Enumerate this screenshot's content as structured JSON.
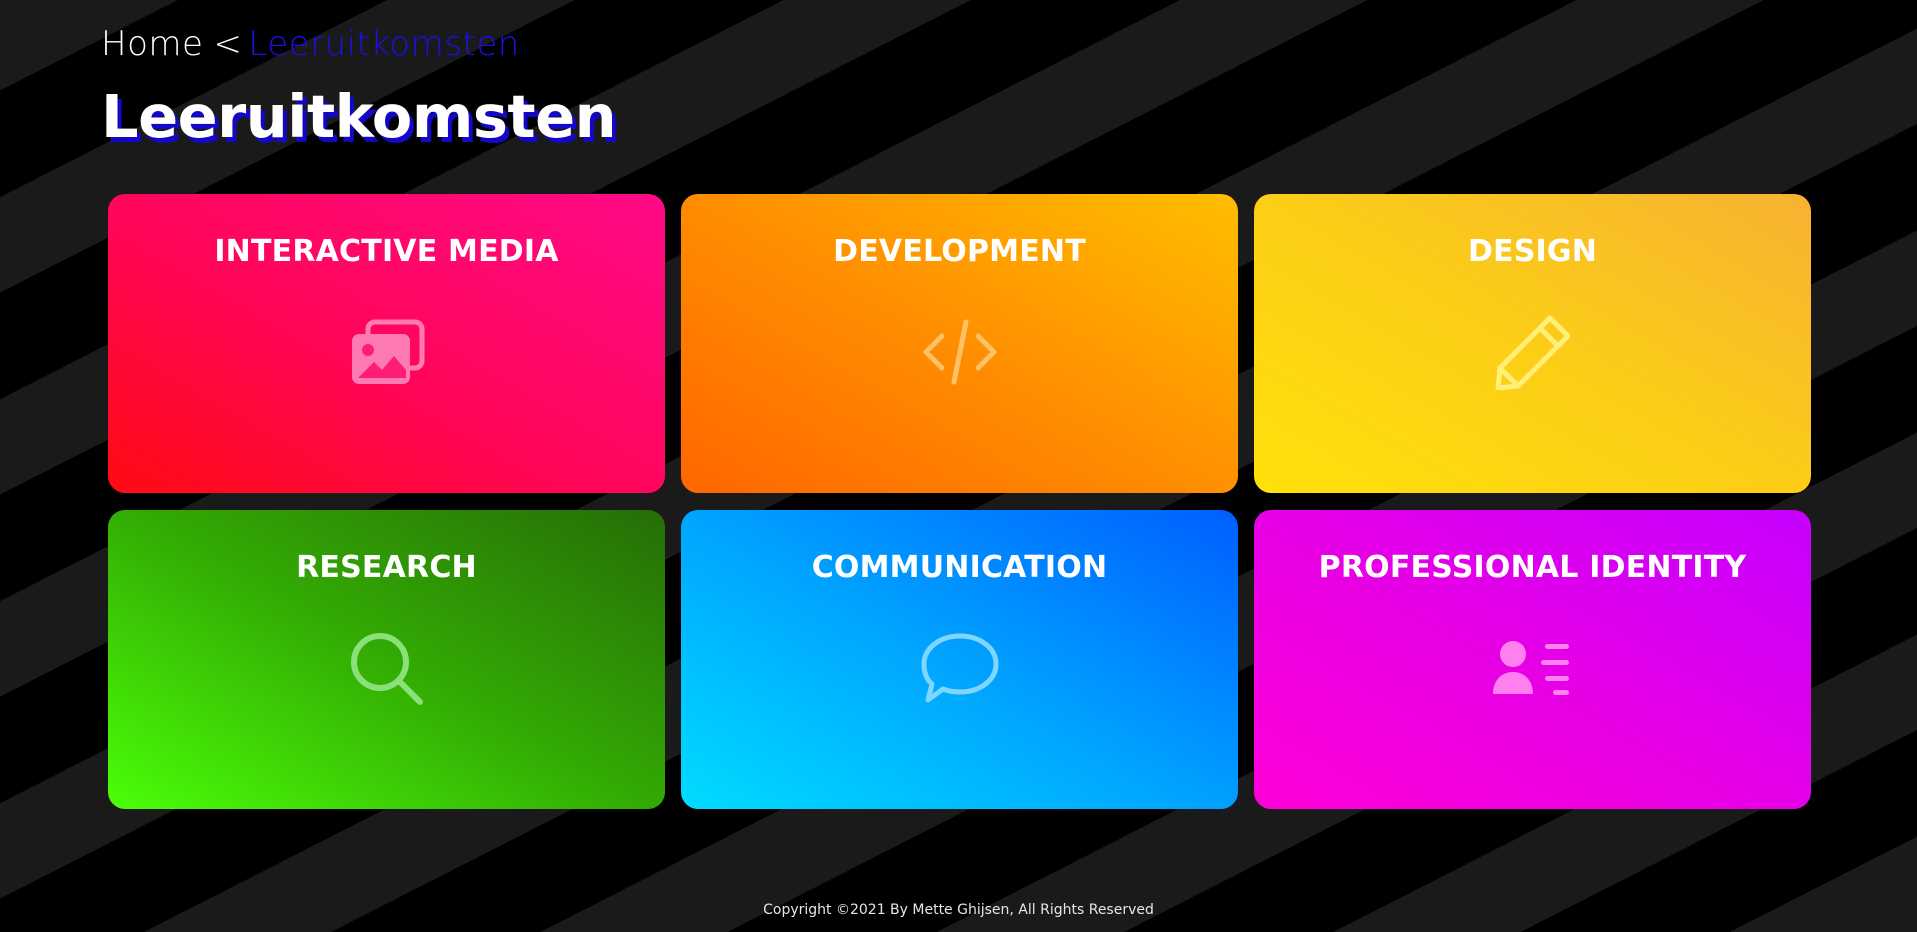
{
  "breadcrumb": {
    "home": "Home",
    "separator": "<",
    "current": "Leeruitkomsten"
  },
  "page_title": "Leeruitkomsten",
  "cards": [
    {
      "title": "INTERACTIVE MEDIA",
      "icon": "images-icon",
      "gradient": [
        "#ff0a12",
        "#ff0a88"
      ]
    },
    {
      "title": "DEVELOPMENT",
      "icon": "code-icon",
      "gradient": [
        "#ff6600",
        "#ffbe00"
      ]
    },
    {
      "title": "DESIGN",
      "icon": "pencil-icon",
      "gradient": [
        "#ffe10a",
        "#f6b232"
      ]
    },
    {
      "title": "RESEARCH",
      "icon": "search-icon",
      "gradient": [
        "#4bff08",
        "#266d07"
      ]
    },
    {
      "title": "COMMUNICATION",
      "icon": "chat-bubble-icon",
      "gradient": [
        "#00dcff",
        "#005eff"
      ]
    },
    {
      "title": "PROFESSIONAL IDENTITY",
      "icon": "id-card-icon",
      "gradient": [
        "#ff00d8",
        "#c600ff"
      ]
    }
  ],
  "footer": {
    "copyright": "Copyright ©2021 By Mette Ghijsen, All Rights Reserved"
  },
  "colors": {
    "background": "#000000",
    "stripe": "#1a1a1a",
    "accent_blue": "#1a10e8",
    "title_shadow": "#1308c9"
  }
}
